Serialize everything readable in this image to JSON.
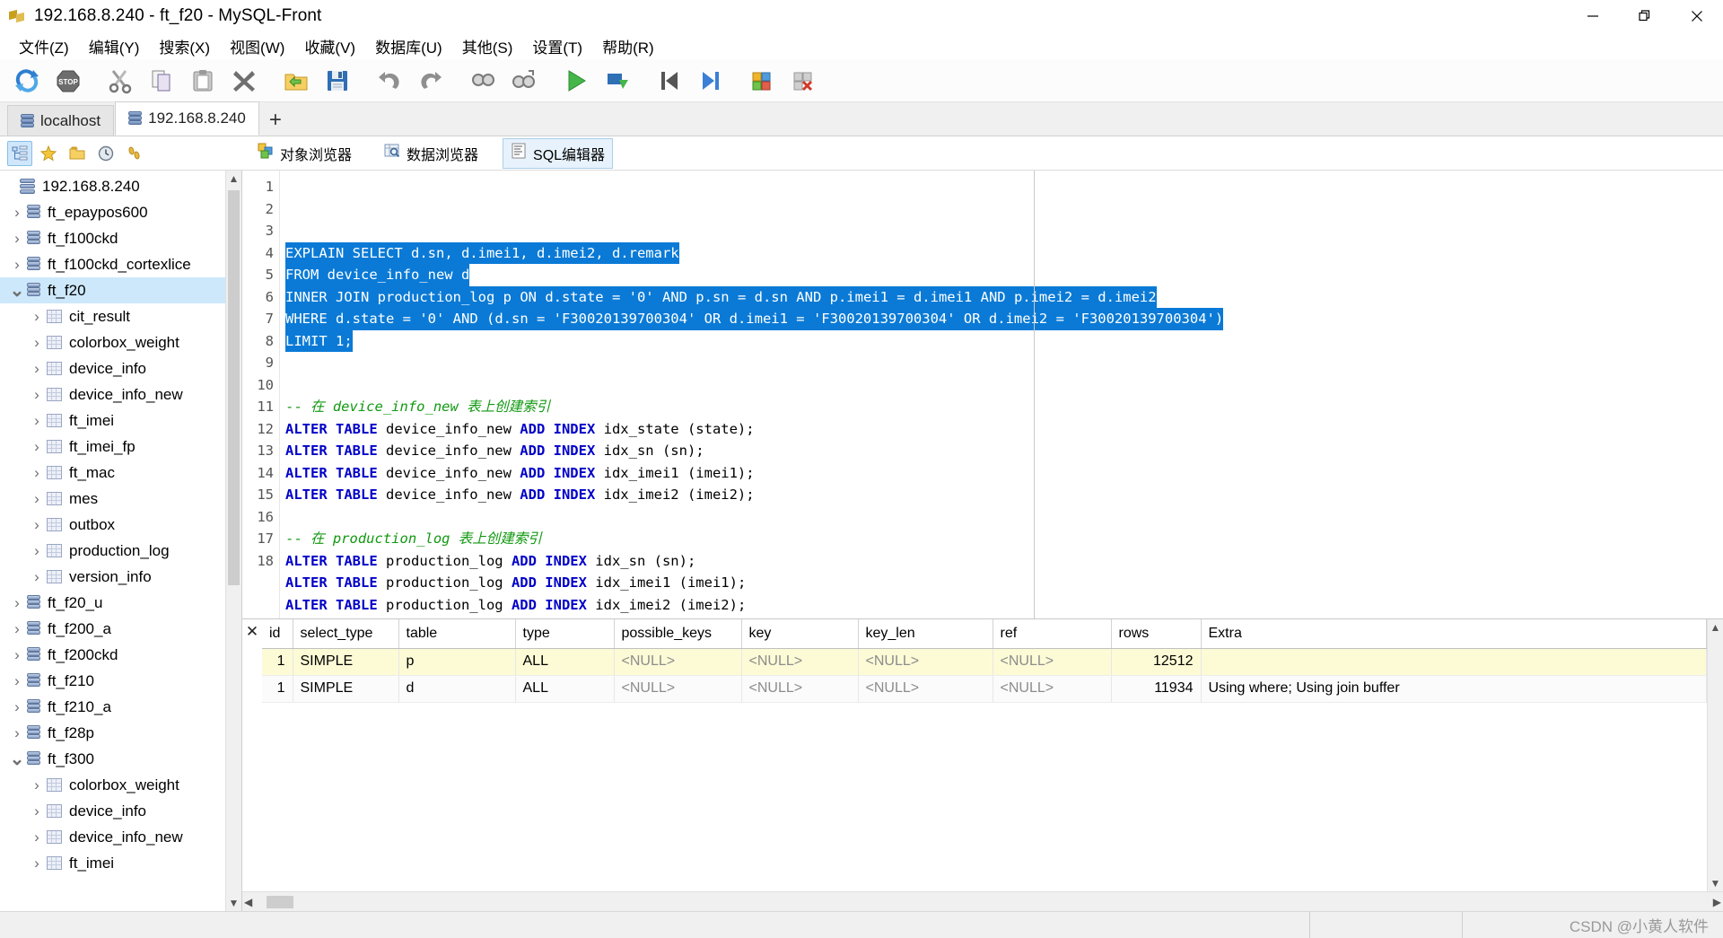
{
  "window": {
    "title": "192.168.8.240 - ft_f20 - MySQL-Front",
    "icon": "app-icon",
    "minimize": "minimize-icon",
    "maximize": "maximize-icon",
    "close": "close-icon"
  },
  "menu": [
    {
      "label": "文件(Z)",
      "text": "文件",
      "acc": "Z"
    },
    {
      "label": "编辑(Y)",
      "text": "编辑",
      "acc": "Y"
    },
    {
      "label": "搜索(X)",
      "text": "搜索",
      "acc": "X"
    },
    {
      "label": "视图(W)",
      "text": "视图",
      "acc": "W"
    },
    {
      "label": "收藏(V)",
      "text": "收藏",
      "acc": "V"
    },
    {
      "label": "数据库(U)",
      "text": "数据库",
      "acc": "U"
    },
    {
      "label": "其他(S)",
      "text": "其他",
      "acc": "S"
    },
    {
      "label": "设置(T)",
      "text": "设置",
      "acc": "T"
    },
    {
      "label": "帮助(R)",
      "text": "帮助",
      "acc": "R"
    }
  ],
  "toolbar": [
    {
      "name": "refresh-icon",
      "title": "刷新"
    },
    {
      "name": "stop-icon",
      "title": "停止"
    },
    {
      "name": "cut-icon",
      "title": "剪切"
    },
    {
      "name": "copy-icon",
      "title": "复制"
    },
    {
      "name": "paste-icon",
      "title": "粘贴"
    },
    {
      "name": "delete-icon",
      "title": "删除"
    },
    {
      "name": "open-folder-icon",
      "title": "打开"
    },
    {
      "name": "save-icon",
      "title": "保存"
    },
    {
      "name": "undo-icon",
      "title": "撤销"
    },
    {
      "name": "redo-icon",
      "title": "重做"
    },
    {
      "name": "find-icon",
      "title": "查找"
    },
    {
      "name": "find-replace-icon",
      "title": "替换"
    },
    {
      "name": "run-icon",
      "title": "执行"
    },
    {
      "name": "run-step-icon",
      "title": "单步执行"
    },
    {
      "name": "first-icon",
      "title": "第一条"
    },
    {
      "name": "last-icon",
      "title": "最后一条"
    },
    {
      "name": "add-row-icon",
      "title": "新增"
    },
    {
      "name": "delete-row-icon",
      "title": "删除"
    }
  ],
  "connection_tabs": {
    "items": [
      {
        "label": "localhost",
        "active": false
      },
      {
        "label": "192.168.8.240",
        "active": true
      }
    ],
    "add_label": "+"
  },
  "subbar": {
    "left_buttons": [
      {
        "name": "objects-tree-button",
        "selected": true
      },
      {
        "name": "favorites-star-button",
        "selected": false
      },
      {
        "name": "folder-button",
        "selected": false
      },
      {
        "name": "history-clock-button",
        "selected": false
      },
      {
        "name": "footprints-button",
        "selected": false
      }
    ],
    "view_tabs": [
      {
        "label": "对象浏览器",
        "icon": "objects-icon",
        "active": false
      },
      {
        "label": "数据浏览器",
        "icon": "data-browser-icon",
        "active": false
      },
      {
        "label": "SQL编辑器",
        "icon": "sql-editor-icon",
        "active": true
      }
    ]
  },
  "sidebar": {
    "root": {
      "label": "192.168.8.240",
      "icon": "server-icon",
      "level": 0,
      "expanded": true
    },
    "items": [
      {
        "label": "ft_epaypos600",
        "type": "database",
        "level": 1,
        "expanded": false,
        "selected": false
      },
      {
        "label": "ft_f100ckd",
        "type": "database",
        "level": 1,
        "expanded": false,
        "selected": false
      },
      {
        "label": "ft_f100ckd_cortexlice",
        "type": "database",
        "level": 1,
        "expanded": false,
        "selected": false
      },
      {
        "label": "ft_f20",
        "type": "database",
        "level": 1,
        "expanded": true,
        "selected": true
      },
      {
        "label": "cit_result",
        "type": "table",
        "level": 2,
        "expanded": false,
        "selected": false
      },
      {
        "label": "colorbox_weight",
        "type": "table",
        "level": 2,
        "expanded": false,
        "selected": false
      },
      {
        "label": "device_info",
        "type": "table",
        "level": 2,
        "expanded": false,
        "selected": false
      },
      {
        "label": "device_info_new",
        "type": "table",
        "level": 2,
        "expanded": false,
        "selected": false
      },
      {
        "label": "ft_imei",
        "type": "table",
        "level": 2,
        "expanded": false,
        "selected": false
      },
      {
        "label": "ft_imei_fp",
        "type": "table",
        "level": 2,
        "expanded": false,
        "selected": false
      },
      {
        "label": "ft_mac",
        "type": "table",
        "level": 2,
        "expanded": false,
        "selected": false
      },
      {
        "label": "mes",
        "type": "table",
        "level": 2,
        "expanded": false,
        "selected": false
      },
      {
        "label": "outbox",
        "type": "table",
        "level": 2,
        "expanded": false,
        "selected": false
      },
      {
        "label": "production_log",
        "type": "table",
        "level": 2,
        "expanded": false,
        "selected": false
      },
      {
        "label": "version_info",
        "type": "table",
        "level": 2,
        "expanded": false,
        "selected": false
      },
      {
        "label": "ft_f20_u",
        "type": "database",
        "level": 1,
        "expanded": false,
        "selected": false
      },
      {
        "label": "ft_f200_a",
        "type": "database",
        "level": 1,
        "expanded": false,
        "selected": false
      },
      {
        "label": "ft_f200ckd",
        "type": "database",
        "level": 1,
        "expanded": false,
        "selected": false
      },
      {
        "label": "ft_f210",
        "type": "database",
        "level": 1,
        "expanded": false,
        "selected": false
      },
      {
        "label": "ft_f210_a",
        "type": "database",
        "level": 1,
        "expanded": false,
        "selected": false
      },
      {
        "label": "ft_f28p",
        "type": "database",
        "level": 1,
        "expanded": false,
        "selected": false
      },
      {
        "label": "ft_f300",
        "type": "database",
        "level": 1,
        "expanded": true,
        "selected": false
      },
      {
        "label": "colorbox_weight",
        "type": "table",
        "level": 2,
        "expanded": false,
        "selected": false
      },
      {
        "label": "device_info",
        "type": "table",
        "level": 2,
        "expanded": false,
        "selected": false
      },
      {
        "label": "device_info_new",
        "type": "table",
        "level": 2,
        "expanded": false,
        "selected": false
      },
      {
        "label": "ft_imei",
        "type": "table",
        "level": 2,
        "expanded": false,
        "selected": false
      }
    ]
  },
  "editor": {
    "lines": [
      {
        "n": "1",
        "selected": true,
        "tokens": [
          {
            "t": "EXPLAIN SELECT",
            "c": "kw"
          },
          {
            "t": " d.sn, d.imei1, d.imei2, d.remark",
            "c": ""
          }
        ]
      },
      {
        "n": "2",
        "selected": true,
        "tokens": [
          {
            "t": "FROM",
            "c": "kw"
          },
          {
            "t": " device_info_new d",
            "c": ""
          }
        ]
      },
      {
        "n": "3",
        "selected": true,
        "tokens": [
          {
            "t": "INNER JOIN",
            "c": "kw"
          },
          {
            "t": " production_log p ",
            "c": ""
          },
          {
            "t": "ON",
            "c": "kw"
          },
          {
            "t": " d.state = '0' ",
            "c": ""
          },
          {
            "t": "AND",
            "c": "kw"
          },
          {
            "t": " p.sn = d.sn ",
            "c": ""
          },
          {
            "t": "AND",
            "c": "kw"
          },
          {
            "t": " p.imei1 = d.imei1 ",
            "c": ""
          },
          {
            "t": "AND",
            "c": "kw"
          },
          {
            "t": " p.imei2 = d.imei2",
            "c": ""
          }
        ]
      },
      {
        "n": "4",
        "selected": true,
        "tokens": [
          {
            "t": "WHERE",
            "c": "kw"
          },
          {
            "t": " d.state = '0' ",
            "c": ""
          },
          {
            "t": "AND",
            "c": "kw"
          },
          {
            "t": " (d.sn = 'F30020139700304' ",
            "c": ""
          },
          {
            "t": "OR",
            "c": "kw"
          },
          {
            "t": " d.imei1 = 'F30020139700304' ",
            "c": ""
          },
          {
            "t": "OR",
            "c": "kw"
          },
          {
            "t": " d.imei2 = 'F30020139700304')",
            "c": ""
          }
        ]
      },
      {
        "n": "5",
        "selected": true,
        "tokens": [
          {
            "t": "LIMIT",
            "c": "kw"
          },
          {
            "t": " 1;",
            "c": ""
          }
        ]
      },
      {
        "n": "6",
        "selected": false,
        "tokens": []
      },
      {
        "n": "7",
        "selected": false,
        "tokens": []
      },
      {
        "n": "8",
        "selected": false,
        "tokens": [
          {
            "t": "-- ",
            "c": "cmt"
          },
          {
            "t": "在 device_info_new 表上创建索引",
            "c": "cmt-i"
          }
        ]
      },
      {
        "n": "9",
        "selected": false,
        "tokens": [
          {
            "t": "ALTER TABLE",
            "c": "kw"
          },
          {
            "t": " device_info_new ",
            "c": ""
          },
          {
            "t": "ADD INDEX",
            "c": "kw"
          },
          {
            "t": " idx_state (state);",
            "c": ""
          }
        ]
      },
      {
        "n": "10",
        "selected": false,
        "tokens": [
          {
            "t": "ALTER TABLE",
            "c": "kw"
          },
          {
            "t": " device_info_new ",
            "c": ""
          },
          {
            "t": "ADD INDEX",
            "c": "kw"
          },
          {
            "t": " idx_sn (sn);",
            "c": ""
          }
        ]
      },
      {
        "n": "11",
        "selected": false,
        "tokens": [
          {
            "t": "ALTER TABLE",
            "c": "kw"
          },
          {
            "t": " device_info_new ",
            "c": ""
          },
          {
            "t": "ADD INDEX",
            "c": "kw"
          },
          {
            "t": " idx_imei1 (imei1);",
            "c": ""
          }
        ]
      },
      {
        "n": "12",
        "selected": false,
        "tokens": [
          {
            "t": "ALTER TABLE",
            "c": "kw"
          },
          {
            "t": " device_info_new ",
            "c": ""
          },
          {
            "t": "ADD INDEX",
            "c": "kw"
          },
          {
            "t": " idx_imei2 (imei2);",
            "c": ""
          }
        ]
      },
      {
        "n": "13",
        "selected": false,
        "tokens": []
      },
      {
        "n": "14",
        "selected": false,
        "tokens": [
          {
            "t": "-- ",
            "c": "cmt"
          },
          {
            "t": "在 production_log 表上创建索引",
            "c": "cmt-i"
          }
        ]
      },
      {
        "n": "15",
        "selected": false,
        "tokens": [
          {
            "t": "ALTER TABLE",
            "c": "kw"
          },
          {
            "t": " production_log ",
            "c": ""
          },
          {
            "t": "ADD INDEX",
            "c": "kw"
          },
          {
            "t": " idx_sn (sn);",
            "c": ""
          }
        ]
      },
      {
        "n": "16",
        "selected": false,
        "tokens": [
          {
            "t": "ALTER TABLE",
            "c": "kw"
          },
          {
            "t": " production_log ",
            "c": ""
          },
          {
            "t": "ADD INDEX",
            "c": "kw"
          },
          {
            "t": " idx_imei1 (imei1);",
            "c": ""
          }
        ]
      },
      {
        "n": "17",
        "selected": false,
        "tokens": [
          {
            "t": "ALTER TABLE",
            "c": "kw"
          },
          {
            "t": " production_log ",
            "c": ""
          },
          {
            "t": "ADD INDEX",
            "c": "kw"
          },
          {
            "t": " idx_imei2 (imei2);",
            "c": ""
          }
        ]
      },
      {
        "n": "18",
        "selected": false,
        "tokens": []
      }
    ]
  },
  "results": {
    "close_label": "✕",
    "columns": [
      "id",
      "select_type",
      "table",
      "type",
      "possible_keys",
      "key",
      "key_len",
      "ref",
      "rows",
      "Extra"
    ],
    "rows": [
      {
        "id": "1",
        "select_type": "SIMPLE",
        "table": "p",
        "type": "ALL",
        "possible_keys": "<NULL>",
        "key": "<NULL>",
        "key_len": "<NULL>",
        "ref": "<NULL>",
        "rows": "12512",
        "Extra": ""
      },
      {
        "id": "1",
        "select_type": "SIMPLE",
        "table": "d",
        "type": "ALL",
        "possible_keys": "<NULL>",
        "key": "<NULL>",
        "key_len": "<NULL>",
        "ref": "<NULL>",
        "rows": "11934",
        "Extra": "Using where; Using join buffer"
      }
    ]
  },
  "statusbar": {
    "watermark": "CSDN @小黄人软件"
  }
}
